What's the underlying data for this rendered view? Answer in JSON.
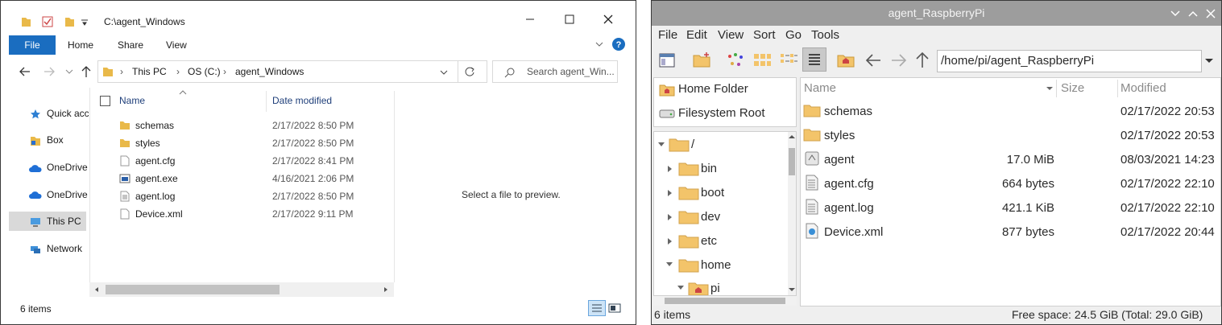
{
  "windows": {
    "title": "C:\\agent_Windows",
    "ribbon_tabs": [
      "File",
      "Home",
      "Share",
      "View"
    ],
    "address": [
      "This PC",
      "OS (C:)",
      "agent_Windows"
    ],
    "search_placeholder": "Search agent_Win...",
    "nav": [
      "Quick acc",
      "Box",
      "OneDrive",
      "OneDrive",
      "This PC",
      "Network"
    ],
    "columns": {
      "name": "Name",
      "date": "Date modified"
    },
    "files": [
      {
        "name": "schemas",
        "date": "2/17/2022 8:50 PM",
        "icon": "folder-icon"
      },
      {
        "name": "styles",
        "date": "2/17/2022 8:50 PM",
        "icon": "folder-icon"
      },
      {
        "name": "agent.cfg",
        "date": "2/17/2022 8:41 PM",
        "icon": "file-icon"
      },
      {
        "name": "agent.exe",
        "date": "4/16/2021 2:06 PM",
        "icon": "exe-icon"
      },
      {
        "name": "agent.log",
        "date": "2/17/2022 8:50 PM",
        "icon": "text-file-icon"
      },
      {
        "name": "Device.xml",
        "date": "2/17/2022 9:11 PM",
        "icon": "file-icon"
      }
    ],
    "preview_text": "Select a file to preview.",
    "status": "6 items",
    "accent": "#1a6dc0"
  },
  "rpi": {
    "title": "agent_RaspberryPi",
    "menu": [
      "File",
      "Edit",
      "View",
      "Sort",
      "Go",
      "Tools"
    ],
    "path": "/home/pi/agent_RaspberryPi",
    "places": [
      "Home Folder",
      "Filesystem Root"
    ],
    "tree": [
      "/",
      "bin",
      "boot",
      "dev",
      "etc",
      "home",
      "pi"
    ],
    "columns": {
      "name": "Name",
      "size": "Size",
      "modified": "Modified"
    },
    "files": [
      {
        "name": "schemas",
        "size": "",
        "date": "02/17/2022 20:53",
        "icon": "folder-icon"
      },
      {
        "name": "styles",
        "size": "",
        "date": "02/17/2022 20:53",
        "icon": "folder-icon"
      },
      {
        "name": "agent",
        "size": "17.0 MiB",
        "date": "08/03/2021 14:23",
        "icon": "executable-icon"
      },
      {
        "name": "agent.cfg",
        "size": "664 bytes",
        "date": "02/17/2022 22:10",
        "icon": "text-file-icon"
      },
      {
        "name": "agent.log",
        "size": "421.1 KiB",
        "date": "02/17/2022 22:10",
        "icon": "text-file-icon"
      },
      {
        "name": "Device.xml",
        "size": "877 bytes",
        "date": "02/17/2022 20:44",
        "icon": "xml-file-icon"
      }
    ],
    "status_left": "6 items",
    "status_right": "Free space: 24.5 GiB (Total: 29.0 GiB)",
    "folder_color": "#f3c46a"
  }
}
